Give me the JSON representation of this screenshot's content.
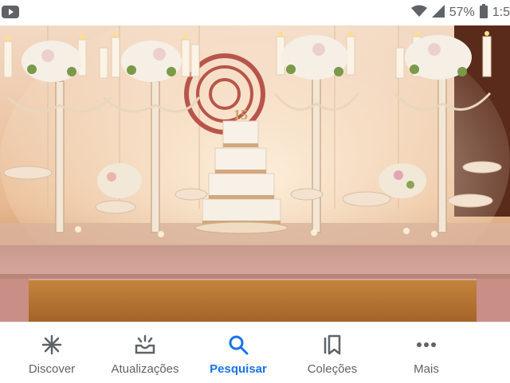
{
  "status_bar": {
    "battery_percent": "57%",
    "time": "1:5",
    "icons": [
      "youtube-notification-icon",
      "wifi-icon",
      "signal-icon",
      "battery-icon"
    ]
  },
  "image": {
    "subject": "wedding-cake-table",
    "cake_topper": "15"
  },
  "bottom_nav": {
    "active_color": "#1a73e8",
    "inactive_color": "#5f6368",
    "items": [
      {
        "label": "Discover",
        "icon": "asterisk-icon"
      },
      {
        "label": "Atualizações",
        "icon": "updates-tray-icon"
      },
      {
        "label": "Pesquisar",
        "icon": "search-icon",
        "active": true
      },
      {
        "label": "Coleções",
        "icon": "collections-bookmark-icon"
      },
      {
        "label": "Mais",
        "icon": "more-dots-icon"
      }
    ]
  }
}
